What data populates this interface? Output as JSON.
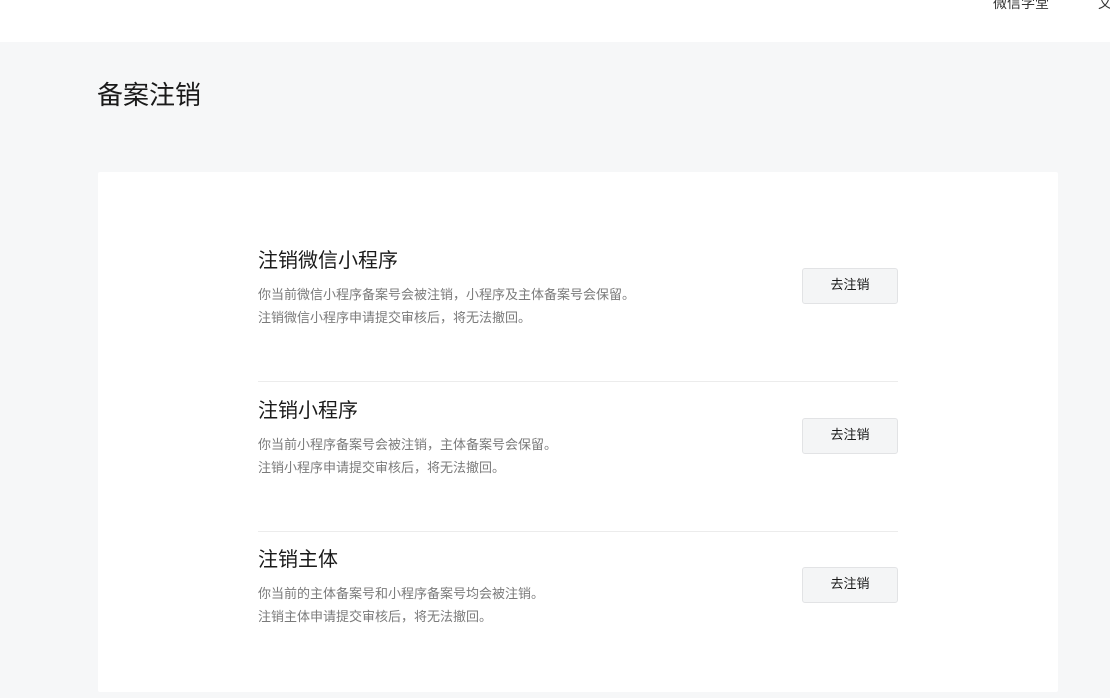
{
  "header": {
    "nav": [
      "微信学堂",
      "文"
    ]
  },
  "page": {
    "title": "备案注销"
  },
  "sections": [
    {
      "title": "注销微信小程序",
      "desc_lines": [
        "你当前微信小程序备案号会被注销，小程序及主体备案号会保留。",
        "注销微信小程序申请提交审核后，将无法撤回。"
      ],
      "button_label": "去注销"
    },
    {
      "title": "注销小程序",
      "desc_lines": [
        "你当前小程序备案号会被注销，主体备案号会保留。",
        "注销小程序申请提交审核后，将无法撤回。"
      ],
      "button_label": "去注销"
    },
    {
      "title": "注销主体",
      "desc_lines": [
        "你当前的主体备案号和小程序备案号均会被注销。",
        "注销主体申请提交审核后，将无法撤回。"
      ],
      "button_label": "去注销"
    }
  ]
}
